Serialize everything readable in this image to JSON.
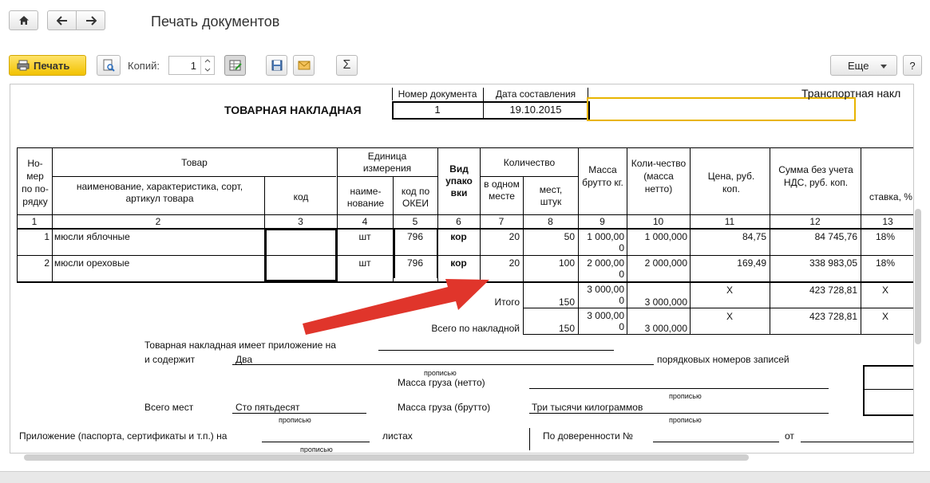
{
  "header": {
    "title": "Печать документов",
    "print_label": "Печать",
    "copies_label": "Копий:",
    "copies_value": "1",
    "more_label": "Еще",
    "help_label": "?"
  },
  "doc": {
    "heading": "ТОВАРНАЯ НАКЛАДНАЯ",
    "num_header": "Номер документа",
    "date_header": "Дата составления",
    "num_value": "1",
    "date_value": "19.10.2015",
    "transport_text": "Транспортная накл"
  },
  "table": {
    "h_num": "Но-мер по по-рядку",
    "h_goods": "Товар",
    "h_goods_name": "наименование, характеристика, сорт, артикул товара",
    "h_code": "код",
    "h_unit": "Единица измерения",
    "h_unit_name": "наиме-нование",
    "h_unit_okei": "код по ОКЕИ",
    "h_pack": "Вид упако вки",
    "h_qty": "Количество",
    "h_qty_one": "в одном месте",
    "h_qty_places": "мест, штук",
    "h_mass": "Масса брутто кг.",
    "h_count": "Коли-чество (масса нетто)",
    "h_price": "Цена, руб. коп.",
    "h_sum": "Сумма без учета НДС, руб. коп.",
    "h_rate": "ставка, %",
    "colnums": [
      "1",
      "2",
      "3",
      "4",
      "5",
      "6",
      "7",
      "8",
      "9",
      "10",
      "11",
      "12",
      "13"
    ],
    "rows": [
      {
        "n": "1",
        "name": "мюсли яблочные",
        "unit": "шт",
        "okei": "796",
        "pack": "кор",
        "one": "20",
        "places": "50",
        "mass_a": "1 000,00",
        "mass_b": "0",
        "net": "1 000,000",
        "price": "84,75",
        "sum": "84 745,76",
        "rate": "18%"
      },
      {
        "n": "2",
        "name": "мюсли ореховые",
        "unit": "шт",
        "okei": "796",
        "pack": "кор",
        "one": "20",
        "places": "100",
        "mass_a": "2 000,00",
        "mass_b": "0",
        "net": "2 000,000",
        "price": "169,49",
        "sum": "338 983,05",
        "rate": "18%"
      }
    ],
    "itogo_label": "Итого",
    "itogo_places": "150",
    "itogo_mass_a": "3 000,00",
    "itogo_mass_b": "0",
    "itogo_net": "3 000,000",
    "itogo_price": "Х",
    "itogo_sum": "423 728,81",
    "itogo_rate": "Х",
    "total_label": "Всего по накладной",
    "total_places": "150",
    "total_mass_a": "3 000,00",
    "total_mass_b": "0",
    "total_net": "3 000,000",
    "total_price": "Х",
    "total_sum": "423 728,81",
    "total_rate": "Х"
  },
  "footer": {
    "appendix_line1": "Товарная накладная имеет приложение на",
    "appendix_line2": "и содержит",
    "contains_value": "Два",
    "records_text": "порядковых номеров записей",
    "propisyu": "прописью",
    "net_mass_label": "Масса груза (нетто)",
    "places_label": "Всего мест",
    "places_value": "Сто пятьдесят",
    "gross_mass_label": "Масса груза (брутто)",
    "gross_mass_value": "Три тысячи килограммов",
    "attachment_label": "Приложение (паспорта, сертификаты и т.п.) на",
    "sheets_label": "листах",
    "proxy_label": "По доверенности №",
    "from_label": "от"
  },
  "colors": {
    "print_button": "#f5c400",
    "arrow": "#e0352b",
    "focus_border": "#e8b400"
  }
}
